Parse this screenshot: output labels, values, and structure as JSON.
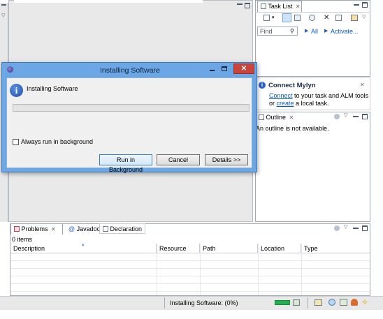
{
  "task_list": {
    "tab_label": "Task List",
    "find_placeholder": "Find",
    "all_label": "All",
    "activate_label": "Activate..."
  },
  "mylyn": {
    "title": "Connect Mylyn",
    "line1_link": "Connect",
    "line1_rest": " to your task and ALM tools",
    "line2_prefix": "or ",
    "line2_link": "create",
    "line2_rest": " a local task."
  },
  "outline": {
    "tab_label": "Outline",
    "message": "An outline is not available."
  },
  "dialog": {
    "title": "Installing Software",
    "message": "Installing Software",
    "checkbox_label": "Always run in background",
    "progress": 0,
    "buttons": {
      "run_bg": "Run in Background",
      "cancel": "Cancel",
      "details": "Details >>"
    }
  },
  "bottom": {
    "tabs": [
      "Problems",
      "Javadoc",
      "Declaration"
    ],
    "count": "0 items",
    "columns": [
      "Description",
      "Resource",
      "Path",
      "Location",
      "Type"
    ]
  },
  "status": {
    "text": "Installing Software: (0%)"
  },
  "colors": {
    "dialog_frame": "#6aa7e4",
    "close_red": "#c9443a",
    "info_blue": "#2d62c8",
    "progress_green": "#22b14c"
  }
}
